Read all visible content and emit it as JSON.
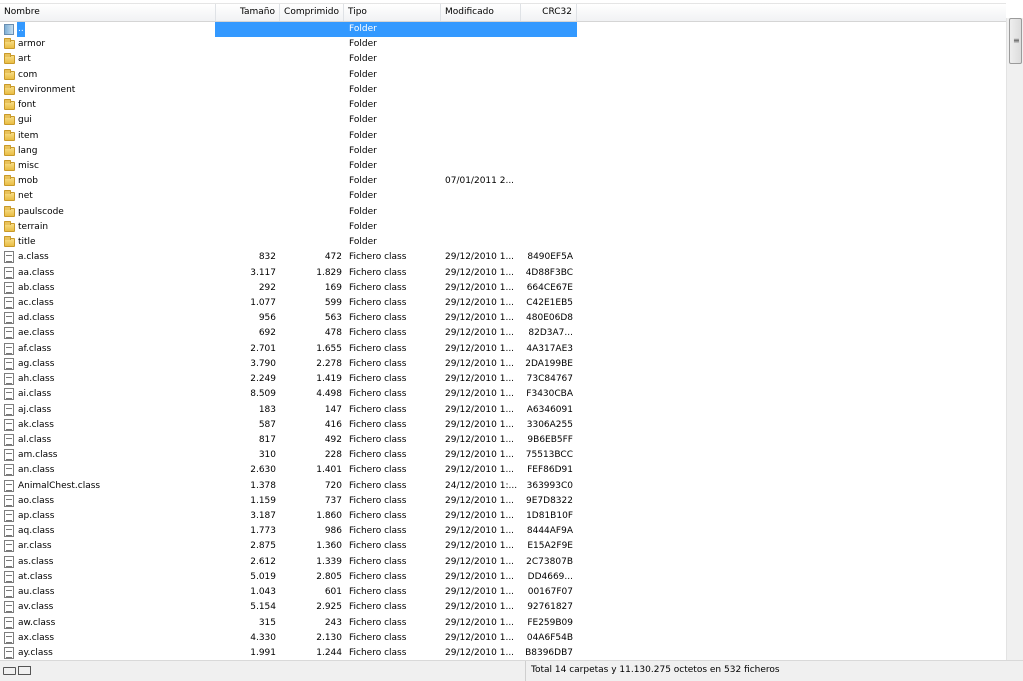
{
  "columns": {
    "name": "Nombre",
    "size": "Tamaño",
    "compressed": "Comprimido",
    "type": "Tipo",
    "modified": "Modificado",
    "crc": "CRC32"
  },
  "rows": [
    {
      "icon": "up-folder-icon",
      "name": "..",
      "size": "",
      "compressed": "",
      "type": "Folder",
      "modified": "",
      "crc": "",
      "selected": true
    },
    {
      "icon": "folder-icon",
      "name": "armor",
      "size": "",
      "compressed": "",
      "type": "Folder",
      "modified": "",
      "crc": ""
    },
    {
      "icon": "folder-icon",
      "name": "art",
      "size": "",
      "compressed": "",
      "type": "Folder",
      "modified": "",
      "crc": ""
    },
    {
      "icon": "folder-icon",
      "name": "com",
      "size": "",
      "compressed": "",
      "type": "Folder",
      "modified": "",
      "crc": ""
    },
    {
      "icon": "folder-icon",
      "name": "environment",
      "size": "",
      "compressed": "",
      "type": "Folder",
      "modified": "",
      "crc": ""
    },
    {
      "icon": "folder-icon",
      "name": "font",
      "size": "",
      "compressed": "",
      "type": "Folder",
      "modified": "",
      "crc": ""
    },
    {
      "icon": "folder-icon",
      "name": "gui",
      "size": "",
      "compressed": "",
      "type": "Folder",
      "modified": "",
      "crc": ""
    },
    {
      "icon": "folder-icon",
      "name": "item",
      "size": "",
      "compressed": "",
      "type": "Folder",
      "modified": "",
      "crc": ""
    },
    {
      "icon": "folder-icon",
      "name": "lang",
      "size": "",
      "compressed": "",
      "type": "Folder",
      "modified": "",
      "crc": ""
    },
    {
      "icon": "folder-icon",
      "name": "misc",
      "size": "",
      "compressed": "",
      "type": "Folder",
      "modified": "",
      "crc": ""
    },
    {
      "icon": "folder-icon",
      "name": "mob",
      "size": "",
      "compressed": "",
      "type": "Folder",
      "modified": "07/01/2011 2...",
      "crc": ""
    },
    {
      "icon": "folder-icon",
      "name": "net",
      "size": "",
      "compressed": "",
      "type": "Folder",
      "modified": "",
      "crc": ""
    },
    {
      "icon": "folder-icon",
      "name": "paulscode",
      "size": "",
      "compressed": "",
      "type": "Folder",
      "modified": "",
      "crc": ""
    },
    {
      "icon": "folder-icon",
      "name": "terrain",
      "size": "",
      "compressed": "",
      "type": "Folder",
      "modified": "",
      "crc": ""
    },
    {
      "icon": "folder-icon",
      "name": "title",
      "size": "",
      "compressed": "",
      "type": "Folder",
      "modified": "",
      "crc": ""
    },
    {
      "icon": "class-file-icon",
      "name": "a.class",
      "size": "832",
      "compressed": "472",
      "type": "Fichero class",
      "modified": "29/12/2010 1...",
      "crc": "8490EF5A"
    },
    {
      "icon": "class-file-icon",
      "name": "aa.class",
      "size": "3.117",
      "compressed": "1.829",
      "type": "Fichero class",
      "modified": "29/12/2010 1...",
      "crc": "4D88F3BC"
    },
    {
      "icon": "class-file-icon",
      "name": "ab.class",
      "size": "292",
      "compressed": "169",
      "type": "Fichero class",
      "modified": "29/12/2010 1...",
      "crc": "664CE67E"
    },
    {
      "icon": "class-file-icon",
      "name": "ac.class",
      "size": "1.077",
      "compressed": "599",
      "type": "Fichero class",
      "modified": "29/12/2010 1...",
      "crc": "C42E1EB5"
    },
    {
      "icon": "class-file-icon",
      "name": "ad.class",
      "size": "956",
      "compressed": "563",
      "type": "Fichero class",
      "modified": "29/12/2010 1...",
      "crc": "480E06D8"
    },
    {
      "icon": "class-file-icon",
      "name": "ae.class",
      "size": "692",
      "compressed": "478",
      "type": "Fichero class",
      "modified": "29/12/2010 1...",
      "crc": "82D3A7..."
    },
    {
      "icon": "class-file-icon",
      "name": "af.class",
      "size": "2.701",
      "compressed": "1.655",
      "type": "Fichero class",
      "modified": "29/12/2010 1...",
      "crc": "4A317AE3"
    },
    {
      "icon": "class-file-icon",
      "name": "ag.class",
      "size": "3.790",
      "compressed": "2.278",
      "type": "Fichero class",
      "modified": "29/12/2010 1...",
      "crc": "2DA199BE"
    },
    {
      "icon": "class-file-icon",
      "name": "ah.class",
      "size": "2.249",
      "compressed": "1.419",
      "type": "Fichero class",
      "modified": "29/12/2010 1...",
      "crc": "73C84767"
    },
    {
      "icon": "class-file-icon",
      "name": "ai.class",
      "size": "8.509",
      "compressed": "4.498",
      "type": "Fichero class",
      "modified": "29/12/2010 1...",
      "crc": "F3430CBA"
    },
    {
      "icon": "class-file-icon",
      "name": "aj.class",
      "size": "183",
      "compressed": "147",
      "type": "Fichero class",
      "modified": "29/12/2010 1...",
      "crc": "A6346091"
    },
    {
      "icon": "class-file-icon",
      "name": "ak.class",
      "size": "587",
      "compressed": "416",
      "type": "Fichero class",
      "modified": "29/12/2010 1...",
      "crc": "3306A255"
    },
    {
      "icon": "class-file-icon",
      "name": "al.class",
      "size": "817",
      "compressed": "492",
      "type": "Fichero class",
      "modified": "29/12/2010 1...",
      "crc": "9B6EB5FF"
    },
    {
      "icon": "class-file-icon",
      "name": "am.class",
      "size": "310",
      "compressed": "228",
      "type": "Fichero class",
      "modified": "29/12/2010 1...",
      "crc": "75513BCC"
    },
    {
      "icon": "class-file-icon",
      "name": "an.class",
      "size": "2.630",
      "compressed": "1.401",
      "type": "Fichero class",
      "modified": "29/12/2010 1...",
      "crc": "FEF86D91"
    },
    {
      "icon": "class-file-icon",
      "name": "AnimalChest.class",
      "size": "1.378",
      "compressed": "720",
      "type": "Fichero class",
      "modified": "24/12/2010 1:...",
      "crc": "363993C0"
    },
    {
      "icon": "class-file-icon",
      "name": "ao.class",
      "size": "1.159",
      "compressed": "737",
      "type": "Fichero class",
      "modified": "29/12/2010 1...",
      "crc": "9E7D8322"
    },
    {
      "icon": "class-file-icon",
      "name": "ap.class",
      "size": "3.187",
      "compressed": "1.860",
      "type": "Fichero class",
      "modified": "29/12/2010 1...",
      "crc": "1D81B10F"
    },
    {
      "icon": "class-file-icon",
      "name": "aq.class",
      "size": "1.773",
      "compressed": "986",
      "type": "Fichero class",
      "modified": "29/12/2010 1...",
      "crc": "8444AF9A"
    },
    {
      "icon": "class-file-icon",
      "name": "ar.class",
      "size": "2.875",
      "compressed": "1.360",
      "type": "Fichero class",
      "modified": "29/12/2010 1...",
      "crc": "E15A2F9E"
    },
    {
      "icon": "class-file-icon",
      "name": "as.class",
      "size": "2.612",
      "compressed": "1.339",
      "type": "Fichero class",
      "modified": "29/12/2010 1...",
      "crc": "2C73807B"
    },
    {
      "icon": "class-file-icon",
      "name": "at.class",
      "size": "5.019",
      "compressed": "2.805",
      "type": "Fichero class",
      "modified": "29/12/2010 1...",
      "crc": "DD4669..."
    },
    {
      "icon": "class-file-icon",
      "name": "au.class",
      "size": "1.043",
      "compressed": "601",
      "type": "Fichero class",
      "modified": "29/12/2010 1...",
      "crc": "00167F07"
    },
    {
      "icon": "class-file-icon",
      "name": "av.class",
      "size": "5.154",
      "compressed": "2.925",
      "type": "Fichero class",
      "modified": "29/12/2010 1...",
      "crc": "92761827"
    },
    {
      "icon": "class-file-icon",
      "name": "aw.class",
      "size": "315",
      "compressed": "243",
      "type": "Fichero class",
      "modified": "29/12/2010 1...",
      "crc": "FE259B09"
    },
    {
      "icon": "class-file-icon",
      "name": "ax.class",
      "size": "4.330",
      "compressed": "2.130",
      "type": "Fichero class",
      "modified": "29/12/2010 1...",
      "crc": "04A6F54B"
    },
    {
      "icon": "class-file-icon",
      "name": "ay.class",
      "size": "1.991",
      "compressed": "1.244",
      "type": "Fichero class",
      "modified": "29/12/2010 1...",
      "crc": "B8396DB7"
    }
  ],
  "scrollbar": {
    "thumb_icon": "grip-icon"
  },
  "status": {
    "left_icons": [
      "drive-icon",
      "network-icon"
    ],
    "summary": "Total 14 carpetas y 11.130.275 octetos en 532 ficheros"
  },
  "colors": {
    "selection": "#3399ff",
    "folder": "#e9bd44"
  }
}
